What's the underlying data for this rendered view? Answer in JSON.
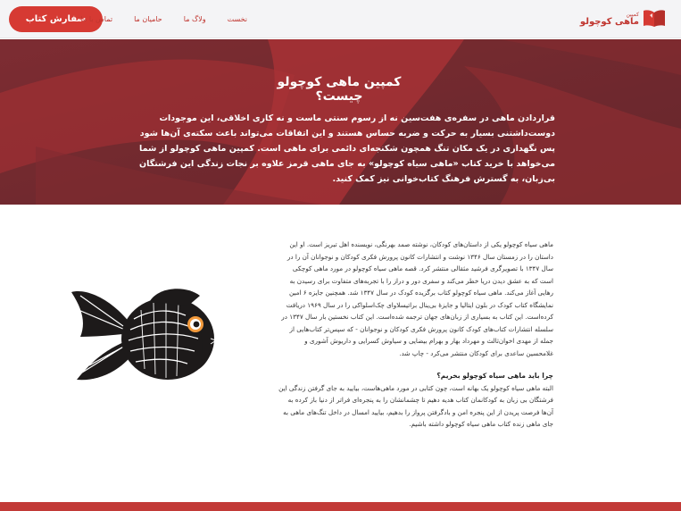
{
  "nav": {
    "cta_label": "سفارش کتاب",
    "links": [
      "نخست",
      "ولاگ ما",
      "حامیان ما",
      "تماس با ما"
    ],
    "logo_small": "کمپین",
    "logo_big": "ماهی کوچولو"
  },
  "hero": {
    "title": "کمپین ماهی کوچولو چیست؟",
    "text": "قراردادن ماهی در سفره‌ی هفت‌سین نه از رسوم سنتی ماست و نه کاری اخلاقی، این موجودات دوست‌داشتنی بسیار به حرکت و ضربه حساس هستند و این اتفاقات می‌تواند باعث سکته‌ی آن‌ها شود پس نگهداری در یک مکان تنگ همچون شکنجه‌ای دائمی برای ماهی است. کمپین ماهی کوچولو از شما می‌خواهد با خرید کتاب «ماهی سیاه کوچولو» به جای ماهی قرمز علاوه بر نجات زندگی این فرشتگان بی‌زبان، به گسترش فرهنگ کتاب‌خوانی نیز کمک کنید."
  },
  "content": {
    "paragraph1": "ماهی سیاه کوچولو یکی از داستان‌های کودکان، نوشته صمد بهرنگی، نویسنده اهل تبریز است. او این داستان را در زمستان سال ۱۳۴۶ نوشت و انتشارات کانون پرورش فکری کودکان و نوجوانان آن را در سال ۱۳۴۷ با تصویرگری فرشید مثقالی منتشر کرد. قصه ماهی سیاه کوچولو در مورد ماهی کوچکی است که به عشق دیدن دریا خطر می‌کند و سفری دور و دراز را با تجربه‌های متفاوت برای رسیدن به رهایی آغاز می‌کند. ماهی سیاه کوچولو کتاب برگزیده کودک در سال ۱۳۴۷ شد. همچنین جایزه ۶ امین نمایشگاه کتاب کودک در بلون ایتالیا و جایزهٔ بی‌ینال براتیسلاوای چک‌اسلواکی را در سال ۱۹۶۹ دریافت کرده‌است. این کتاب به بسیاری از زبان‌های جهان ترجمه شده‌است. این کتاب نخستین بار سال ۱۳۴۷ در سلسله انتشارات کتاب‌های کودک کانون پرورش فکری کودکان و نوجوانان - که سپس‌تر کتاب‌هایی از جمله از مهدی اخوان‌ثالث و مهرداد بهار و بهرام بیضایی و سیاوش کسرایی و داریوش آشوری و غلامحسین ساعدی برای کودکان منتشر می‌کرد - چاپ شد.",
    "question_title": "چرا باید ماهی سیاه کوچولو بخریم؟",
    "paragraph2": "البته ماهی سیاه کوچولو یک بهانه است، چون کتابی در مورد ماهی‌هاست، بیایید به جای گرفتن زندگی این فرشتگان بی زبان به کودکانمان کتاب هدیه دهیم تا چشمانشان را به پنجره‌ای فراتر از دنیا باز کرده به آن‌ها فرصت پریدن از این پنجره امن و بادگرفتن پرواز را بدهیم، بیایید امسال در داخل تنگ‌های ماهی به جای ماهی زنده کتاب ماهی سیاه کوچولو داشته باشیم."
  },
  "colors": {
    "accent": "#d63a33",
    "hero_bg": "#7c2c32",
    "link": "#c0352f"
  }
}
